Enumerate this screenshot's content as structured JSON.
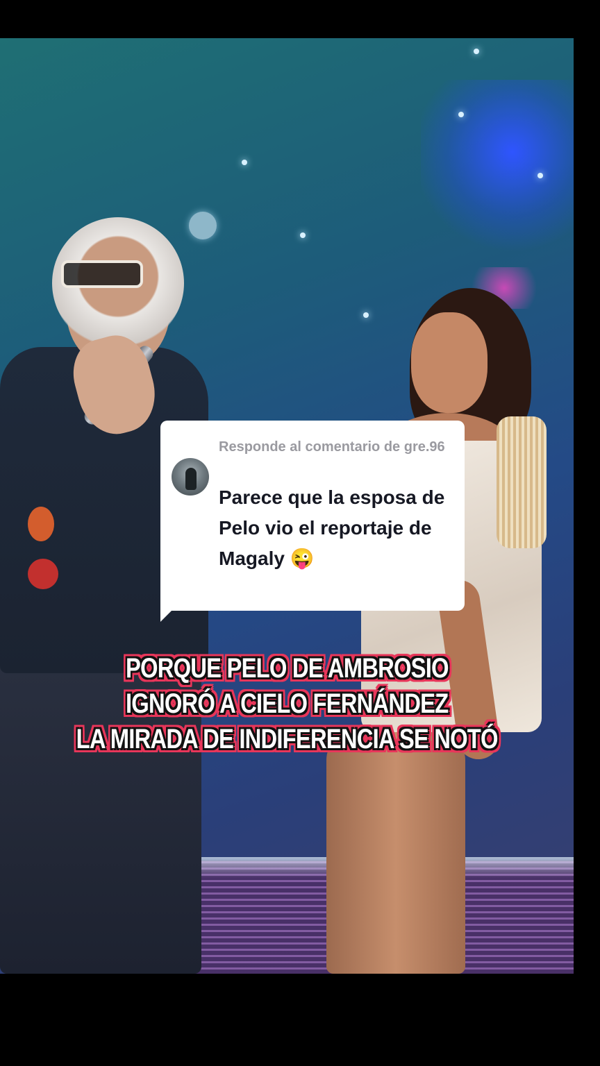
{
  "reply_card": {
    "header": "Responde al comentario de gre.96",
    "comment": "Parece que la esposa de Pelo vio el reportaje de Magaly 😜"
  },
  "captions": [
    "PORQUE PELO DE AMBROSIO",
    "IGNORÓ A CIELO FERNÁNDEZ",
    "LA MIRADA DE INDIFERENCIA SE NOTÓ"
  ],
  "colors": {
    "caption_text": "#ffffff",
    "caption_stroke": "#111111",
    "caption_glow": "#e8365a",
    "reply_card_bg": "#ffffff",
    "reply_header_text": "#9a9aa0",
    "reply_comment_text": "#161823"
  },
  "icons": {
    "commenter_avatar": "avatar"
  }
}
